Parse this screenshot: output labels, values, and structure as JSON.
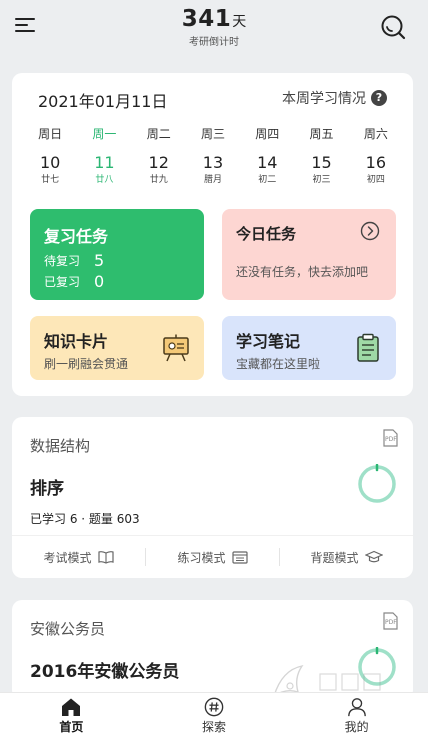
{
  "header": {
    "countdown_number": "341",
    "countdown_unit": "天",
    "countdown_label": "考研倒计时",
    "menu_icon": "hamburger-menu-icon",
    "search_icon": "search-icon"
  },
  "calendar": {
    "date": "2021年01月11日",
    "week_link": "本周学习情况",
    "help_glyph": "?",
    "days": [
      {
        "weekday": "周日",
        "day": "10",
        "lunar": "廿七"
      },
      {
        "weekday": "周一",
        "day": "11",
        "lunar": "廿八",
        "today": true
      },
      {
        "weekday": "周二",
        "day": "12",
        "lunar": "廿九"
      },
      {
        "weekday": "周三",
        "day": "13",
        "lunar": "腊月"
      },
      {
        "weekday": "周四",
        "day": "14",
        "lunar": "初二"
      },
      {
        "weekday": "周五",
        "day": "15",
        "lunar": "初三"
      },
      {
        "weekday": "周六",
        "day": "16",
        "lunar": "初四"
      }
    ]
  },
  "tiles": {
    "review": {
      "title": "复习任务",
      "pending_label": "待复习",
      "pending_value": "5",
      "done_label": "已复习",
      "done_value": "0",
      "color": "#2ebd6e"
    },
    "today": {
      "title": "今日任务",
      "desc": "还没有任务，快去添加吧",
      "color": "#fdd6d2"
    },
    "cards": {
      "title": "知识卡片",
      "desc": "刷一刷融会贯通",
      "icon": "presentation-board-icon",
      "color": "#fde7b8"
    },
    "notes": {
      "title": "学习笔记",
      "desc": "宝藏都在这里啦",
      "icon": "clipboard-icon",
      "color": "#d9e4fb"
    }
  },
  "decks": [
    {
      "subject": "数据结构",
      "title": "排序",
      "stats": "已学习 6 · 题量 603",
      "progress": 0,
      "modes": [
        "考试模式",
        "练习模式",
        "背题模式"
      ]
    },
    {
      "subject": "安徽公务员",
      "title": "2016年安徽公务员",
      "progress": 0
    }
  ],
  "accent_color": "#2bb673",
  "bottom_nav": [
    {
      "label": "首页",
      "icon": "home-icon",
      "active": true
    },
    {
      "label": "探索",
      "icon": "hashtag-icon"
    },
    {
      "label": "我的",
      "icon": "profile-icon"
    }
  ]
}
